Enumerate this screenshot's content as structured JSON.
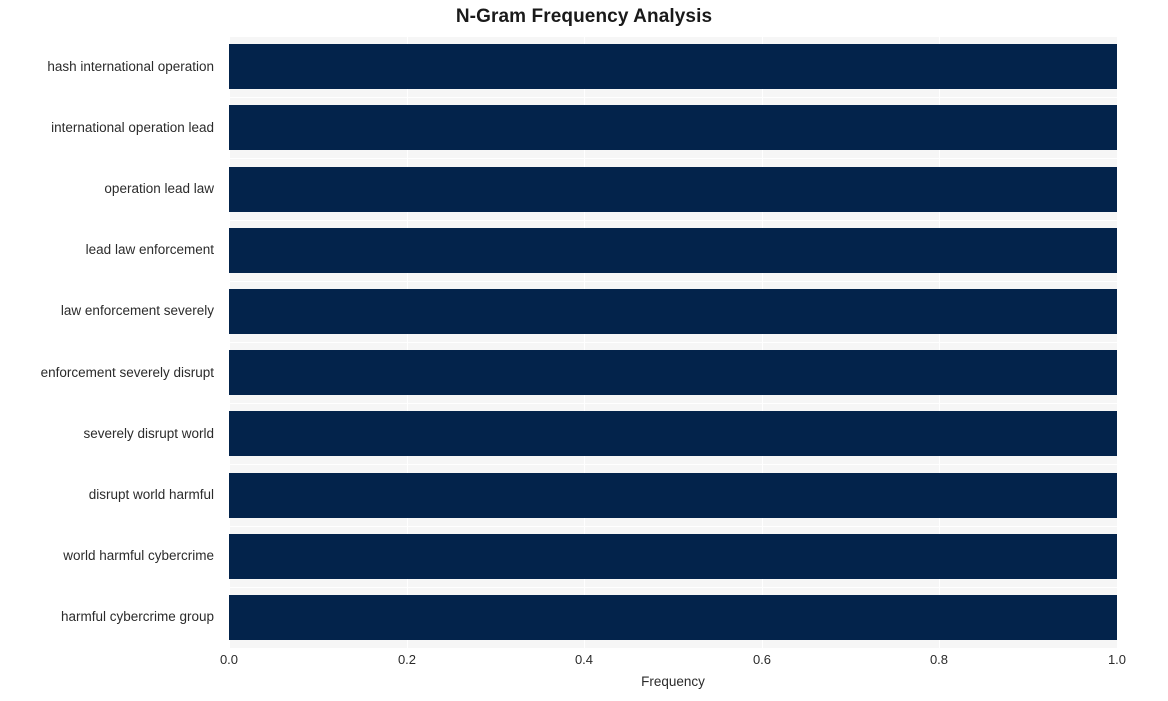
{
  "chart_data": {
    "type": "bar",
    "orientation": "horizontal",
    "title": "N-Gram Frequency Analysis",
    "xlabel": "Frequency",
    "ylabel": "",
    "xlim": [
      0.0,
      1.0
    ],
    "xticks": [
      "0.0",
      "0.2",
      "0.4",
      "0.6",
      "0.8",
      "1.0"
    ],
    "xtick_values": [
      0.0,
      0.2,
      0.4,
      0.6,
      0.8,
      1.0
    ],
    "grid": true,
    "legend": null,
    "bar_color": "#03234b",
    "plot_background": "#f6f6f6",
    "figure_background": "#ffffff",
    "categories": [
      "hash international operation",
      "international operation lead",
      "operation lead law",
      "lead law enforcement",
      "law enforcement severely",
      "enforcement severely disrupt",
      "severely disrupt world",
      "disrupt world harmful",
      "world harmful cybercrime",
      "harmful cybercrime group"
    ],
    "values": [
      1.0,
      1.0,
      1.0,
      1.0,
      1.0,
      1.0,
      1.0,
      1.0,
      1.0,
      1.0
    ]
  }
}
